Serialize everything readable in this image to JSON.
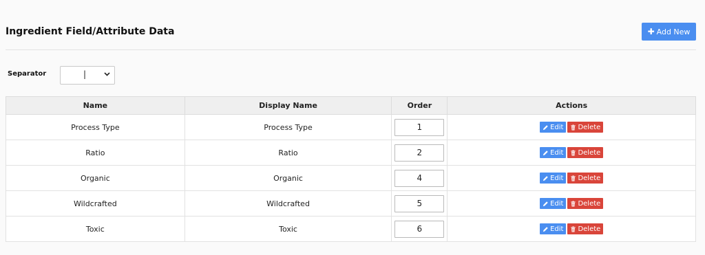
{
  "header": {
    "title": "Ingredient Field/Attribute Data",
    "add_button_label": "Add New"
  },
  "separator": {
    "label": "Separator",
    "selected_value": "|"
  },
  "table": {
    "columns": [
      "Name",
      "Display Name",
      "Order",
      "Actions"
    ],
    "rows": [
      {
        "name": "Process Type",
        "display_name": "Process Type",
        "order": "1"
      },
      {
        "name": "Ratio",
        "display_name": "Ratio",
        "order": "2"
      },
      {
        "name": "Organic",
        "display_name": "Organic",
        "order": "4"
      },
      {
        "name": "Wildcrafted",
        "display_name": "Wildcrafted",
        "order": "5"
      },
      {
        "name": "Toxic",
        "display_name": "Toxic",
        "order": "6"
      }
    ],
    "edit_label": "Edit",
    "delete_label": "Delete"
  },
  "colors": {
    "primary": "#4a8ef0",
    "danger": "#d9453a",
    "header_bg": "#efefef"
  },
  "icons": {
    "add": "plus-icon",
    "edit": "pencil-icon",
    "delete": "trash-icon",
    "select": "chevron-down-icon"
  }
}
